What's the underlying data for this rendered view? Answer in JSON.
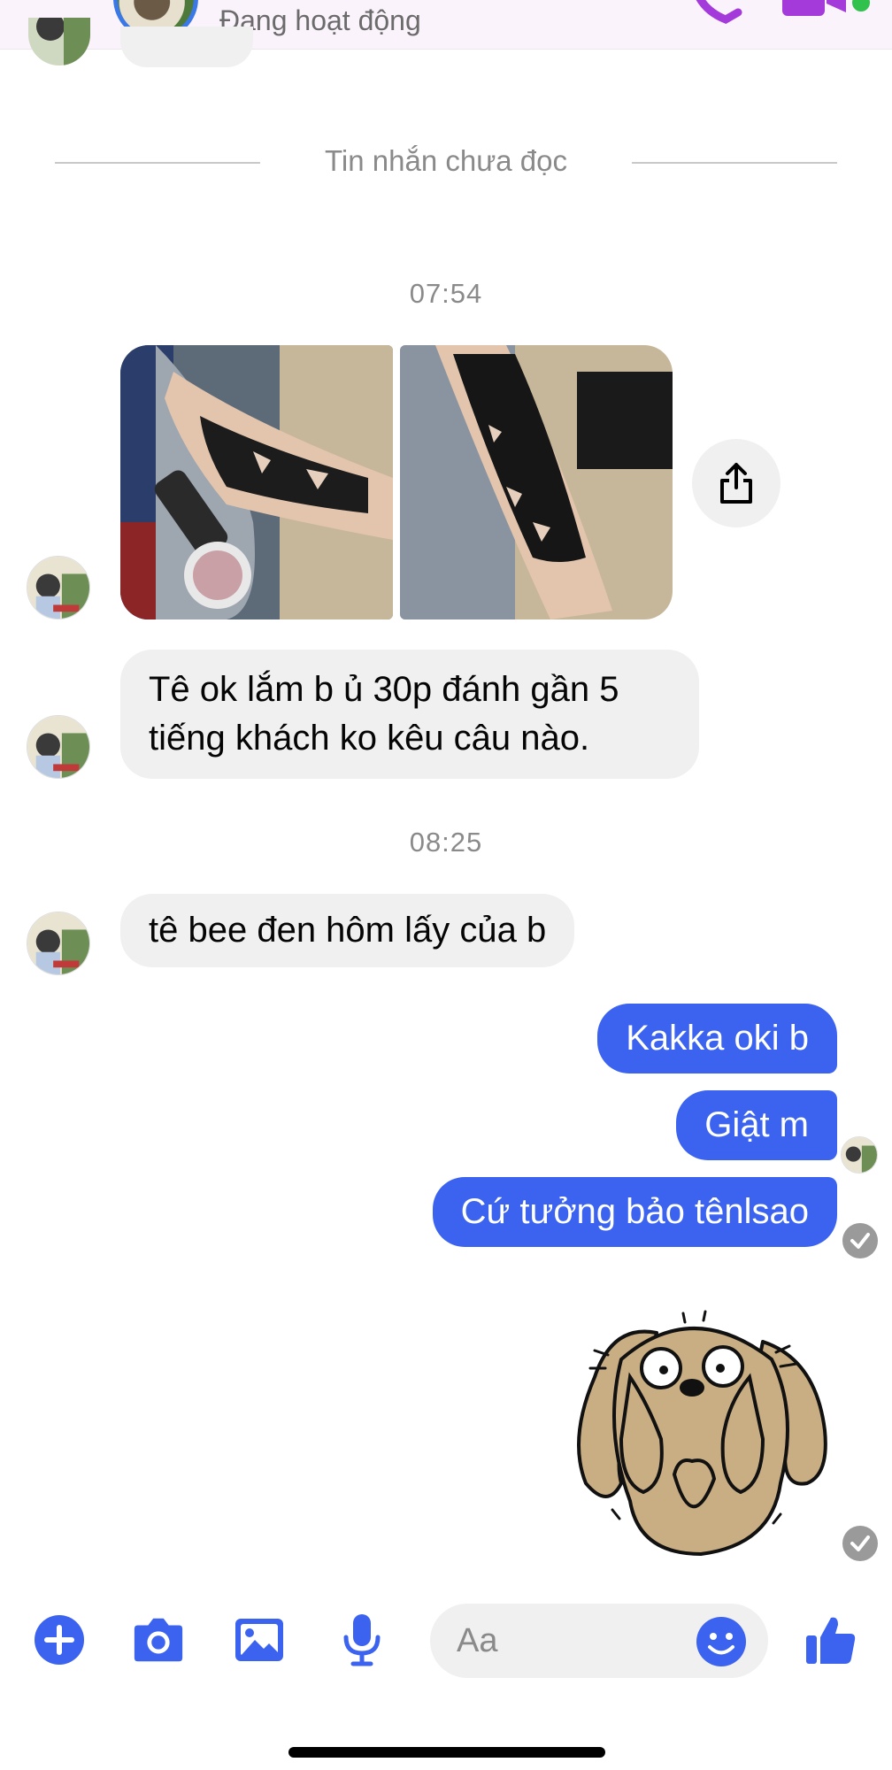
{
  "header": {
    "status": "Đang hoạt động"
  },
  "divider": {
    "label": "Tin nhắn chưa đọc"
  },
  "messages": {
    "time_1": "07:54",
    "incoming_1": "Tê ok lắm b ủ 30p đánh gần 5 tiếng khách ko kêu câu nào.",
    "time_2": "08:25",
    "incoming_2": "tê bee đen hôm lấy của b",
    "outgoing_1": "Kakka oki b",
    "outgoing_2": "Giật m",
    "outgoing_3": "Cứ tưởng bảo tênlsao"
  },
  "composer": {
    "placeholder": "Aa"
  },
  "colors": {
    "accent": "#3b63f0",
    "bubble_incoming": "#f0f0f0",
    "online": "#31c24d"
  },
  "icons": [
    "back-icon",
    "call-icon",
    "video-call-icon",
    "share-icon",
    "add-icon",
    "camera-icon",
    "gallery-icon",
    "microphone-icon",
    "emoji-icon",
    "like-icon",
    "read-receipt-icon"
  ]
}
